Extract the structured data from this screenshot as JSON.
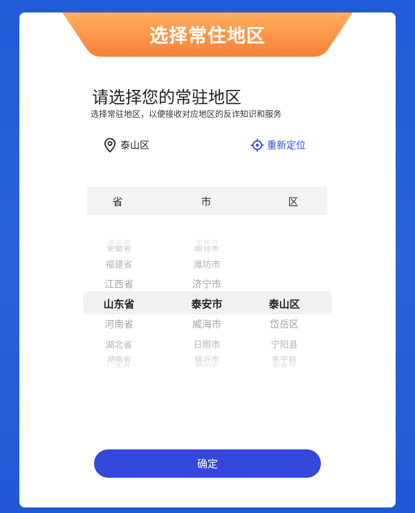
{
  "banner": {
    "title": "选择常住地区"
  },
  "heading": "请选择您的常驻地区",
  "subheading": "选择常驻地区，以便接收对应地区的反诈知识和服务",
  "location": {
    "current": "泰山区",
    "relocate_label": "重新定位",
    "pin_icon": "location-pin-icon",
    "crosshair_icon": "crosshair-icon"
  },
  "picker": {
    "headers": [
      "省",
      "市",
      "区"
    ],
    "provinces": [
      "浙江省",
      "安徽省",
      "福建省",
      "江西省",
      "山东省",
      "河南省",
      "湖北省",
      "湖南省",
      "广东省"
    ],
    "cities": [
      "东营市",
      "烟台市",
      "潍坊市",
      "济宁市",
      "泰安市",
      "威海市",
      "日照市",
      "临沂市",
      "德州市"
    ],
    "districts": [
      "泰山区",
      "岱岳区",
      "宁阳县",
      "东平县",
      "新泰市"
    ],
    "selected": {
      "province": "山东省",
      "city": "泰安市",
      "district": "泰山区"
    }
  },
  "confirm_label": "确定",
  "colors": {
    "background": "#2a63dc",
    "banner_start": "#ffae5c",
    "banner_end": "#f5823a",
    "accent": "#2f4fd9",
    "button": "#3448dc"
  }
}
